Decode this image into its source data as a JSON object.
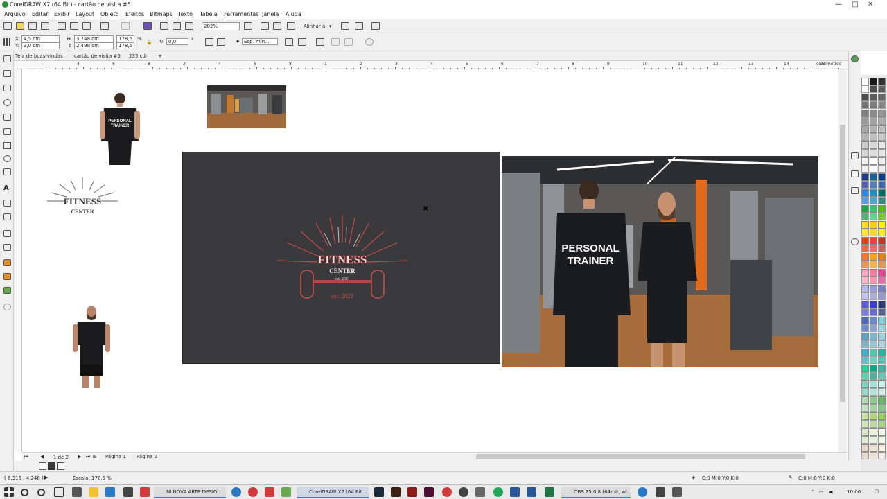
{
  "window": {
    "title": "CorelDRAW X7 (64 Bit) - cartão de visita #5",
    "controls": [
      "—",
      "□",
      "✕"
    ]
  },
  "menu": [
    "Arquivo",
    "Editar",
    "Exibir",
    "Layout",
    "Objeto",
    "Efeitos",
    "Bitmaps",
    "Texto",
    "Tabela",
    "Ferramentas",
    "Janela",
    "Ajuda"
  ],
  "toolbar": {
    "zoom": "202%",
    "align_label": "Alinhar a"
  },
  "property_bar": {
    "x_label": "X:",
    "x": "4,5 cm",
    "y_label": "Y:",
    "y": "3,0 cm",
    "width": "3,748 cm",
    "height": "2,498 cm",
    "scale_w": "178,5",
    "scale_h": "178,5",
    "pct": "%",
    "rotation": "0,0",
    "deg": "°",
    "outline": "Esp. mín..."
  },
  "tabs": [
    "Tela de boas-vindas",
    "cartão de visita #5",
    "233.cdr"
  ],
  "ruler": {
    "unit": "centímetros",
    "numbers": [
      "-",
      "4",
      "6",
      "8",
      "2",
      "4",
      "6",
      "8",
      "1",
      "2",
      "3",
      "4",
      "5",
      "6",
      "7",
      "8",
      "9",
      "10",
      "11",
      "12",
      "13",
      "14",
      "15",
      "16",
      "17",
      "18"
    ]
  },
  "canvas": {
    "logo_small_line1": "FITNESS",
    "logo_small_line2": "CENTER",
    "card_logo_line1": "FITNESS",
    "card_logo_line2": "CENTER",
    "card_logo_line3": "est. 2021",
    "card_logo_line4": "est. 2021",
    "shirt_text_line1": "PERSONAL",
    "shirt_text_line2": "TRAINER",
    "photo_shirt_line1": "PERSONAL",
    "photo_shirt_line2": "TRAINER"
  },
  "pager": {
    "count": "1 de 2",
    "page1": "Página 1",
    "page2": "Página 2"
  },
  "statusbar": {
    "coords": "( 6,316 ; 4,248 )",
    "scale": "Escala: 178,5 %",
    "fill_info": "C:0 M:0 Y:0 K:0",
    "outline_info": "C:0 M:0 Y:0 K:0"
  },
  "taskbar": {
    "windows": [
      "NI NOVA ARTE DESIG...",
      "CorelDRAW X7 (64 Bit...",
      "OBS 25.0.8 (64-bit, wi..."
    ],
    "time": "10:06"
  },
  "colors": {
    "accent": "#d24c4c",
    "card": "#3a3a3c",
    "chrome": "#f0f0f0"
  }
}
